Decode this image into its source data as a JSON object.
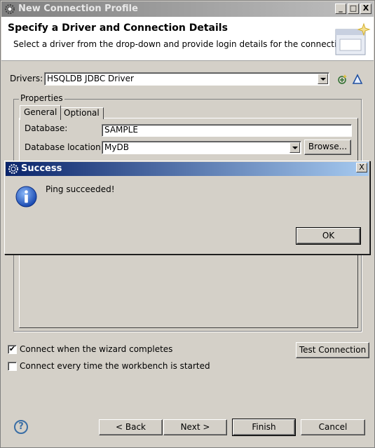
{
  "window": {
    "title": "New Connection Profile",
    "controls": [
      "_",
      "□",
      "X"
    ]
  },
  "header": {
    "title": "Specify a Driver and Connection Details",
    "description": "Select a driver from the drop-down and provide login details for the connection."
  },
  "driver": {
    "label": "Drivers:",
    "value": "HSQLDB JDBC Driver"
  },
  "properties": {
    "title": "Properties",
    "tabs": [
      "General",
      "Optional"
    ],
    "database_label": "Database:",
    "database_value": "SAMPLE",
    "location_label": "Database location:",
    "location_value": "MyDB",
    "browse_label": "Browse..."
  },
  "options": {
    "connect_on_finish_label": "Connect when the wizard completes",
    "connect_on_finish_checked": true,
    "connect_on_start_label": "Connect every time the workbench is started",
    "connect_on_start_checked": false,
    "test_connection_label": "Test Connection"
  },
  "footer": {
    "help_glyph": "?",
    "back_label": "< Back",
    "next_label": "Next >",
    "finish_label": "Finish",
    "cancel_label": "Cancel"
  },
  "dialog": {
    "title": "Success",
    "message": "Ping succeeded!",
    "ok_label": "OK",
    "close_glyph": "X"
  }
}
